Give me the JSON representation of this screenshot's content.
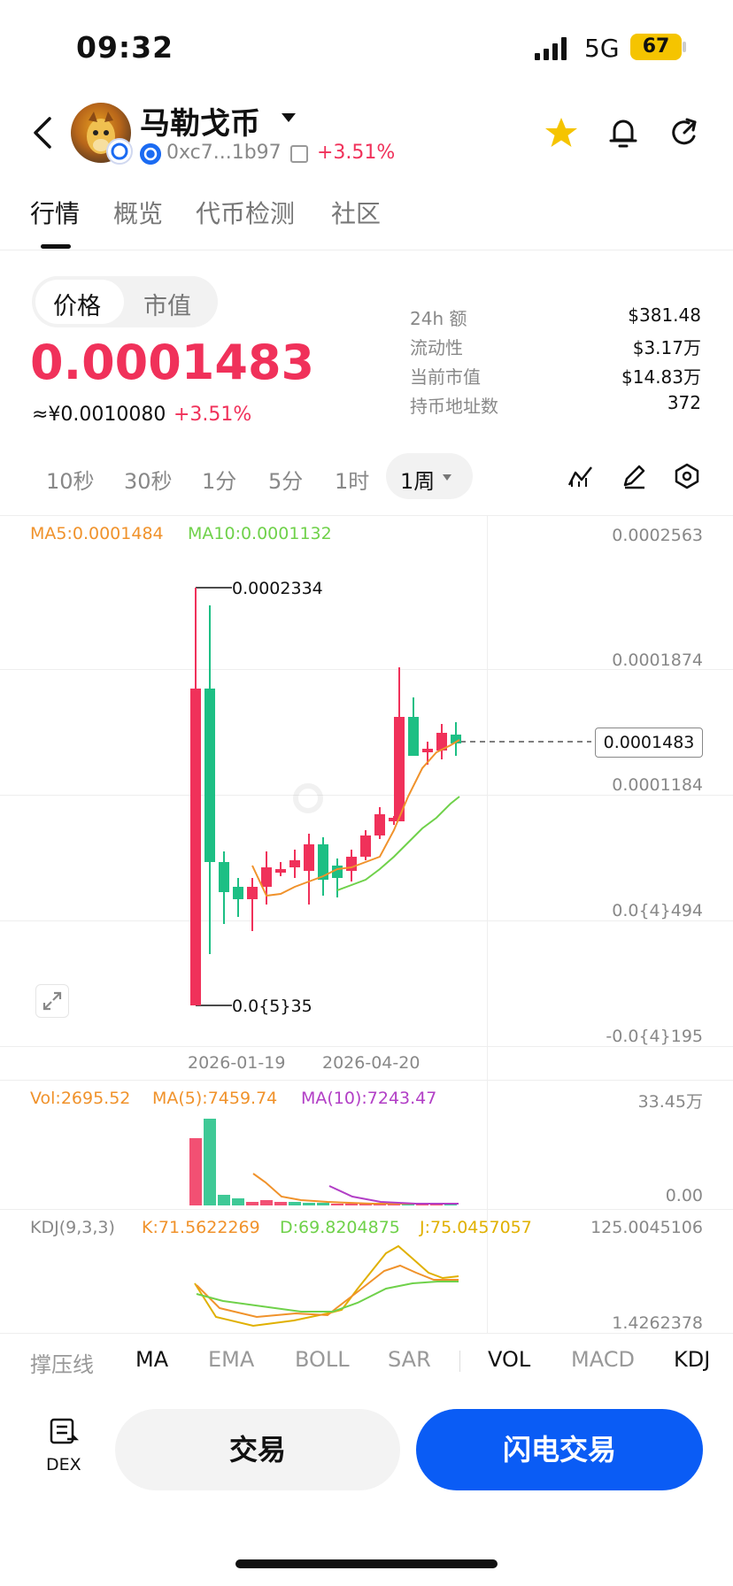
{
  "status": {
    "time": "09:32",
    "network": "5G",
    "battery": "67"
  },
  "header": {
    "name": "马勒戈币",
    "address": "0xc7...1b97",
    "change": "+3.51%"
  },
  "tabs": [
    "行情",
    "概览",
    "代币检测",
    "社区"
  ],
  "price_toggle": [
    "价格",
    "市值"
  ],
  "price": {
    "value": "0.0001483",
    "cny": "≈¥0.0010080",
    "change": "+3.51%"
  },
  "stats": [
    {
      "label": "24h  额",
      "value": "$381.48"
    },
    {
      "label": "流动性",
      "value": "$3.17万"
    },
    {
      "label": "当前市值",
      "value": "$14.83万"
    },
    {
      "label": "持币地址数",
      "value": "372"
    }
  ],
  "timeframes": [
    "10秒",
    "30秒",
    "1分",
    "5分",
    "1时",
    "1周"
  ],
  "main_chart": {
    "ma5": "MA5:0.0001484",
    "ma10": "MA10:0.0001132",
    "axis": [
      "0.0002563",
      "0.0001874",
      "0.0001184",
      "0.0{4}494",
      "-0.0{4}195"
    ],
    "high_label": "0.0002334",
    "low_label": "0.0{5}35",
    "current": "0.0001483",
    "dates": [
      "2026-01-19",
      "2026-04-20"
    ],
    "colors": {
      "up": "#1dbf84",
      "down": "#f0315a",
      "ma5": "#f0922b",
      "ma10": "#6fd14a"
    }
  },
  "volume": {
    "vol": "Vol:2695.52",
    "ma5": "MA(5):7459.74",
    "ma10": "MA(10):7243.47",
    "axis_top": "33.45万",
    "axis_bottom": "0.00"
  },
  "kdj": {
    "title": "KDJ(9,3,3)",
    "k": "K:71.5622269",
    "d": "D:69.8204875",
    "j": "J:75.0457057",
    "axis_top": "125.0045106",
    "axis_bottom": "1.4262378"
  },
  "indicator_tabs": [
    "撑压线",
    "MA",
    "EMA",
    "BOLL",
    "SAR",
    "VOL",
    "MACD",
    "KDJ"
  ],
  "bottom": {
    "dex": "DEX",
    "trade": "交易",
    "flash": "闪电交易"
  }
}
